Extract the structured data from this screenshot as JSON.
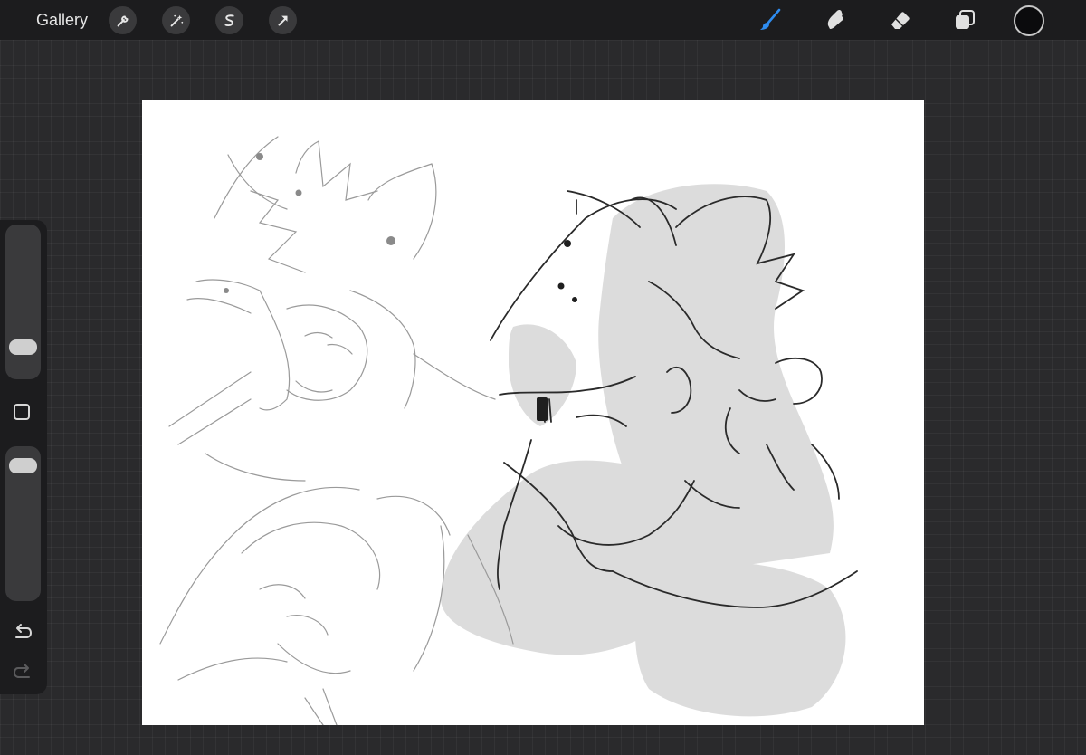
{
  "toolbar": {
    "gallery_label": "Gallery",
    "left_tools": [
      {
        "name": "actions",
        "icon": "wrench-icon"
      },
      {
        "name": "adjustments",
        "icon": "magic-wand-icon"
      },
      {
        "name": "selection",
        "icon": "selection-s-icon"
      },
      {
        "name": "transform",
        "icon": "arrow-cursor-icon"
      }
    ],
    "right_tools": [
      {
        "name": "brush",
        "icon": "brush-icon",
        "active": true,
        "color": "#2e8cf0"
      },
      {
        "name": "smudge",
        "icon": "smudge-finger-icon",
        "active": false
      },
      {
        "name": "eraser",
        "icon": "eraser-icon",
        "active": false
      },
      {
        "name": "layers",
        "icon": "layers-icon",
        "active": false
      }
    ],
    "current_color": "#0b0b0d"
  },
  "sidebar": {
    "brush_size_level": 0.16,
    "opacity_level": 0.94,
    "modify_icon": "square-icon",
    "undo_icon": "undo-icon",
    "redo_icon": "redo-icon",
    "redo_enabled": false
  },
  "canvas": {
    "background": "#ffffff",
    "content": "sketch-artwork"
  }
}
